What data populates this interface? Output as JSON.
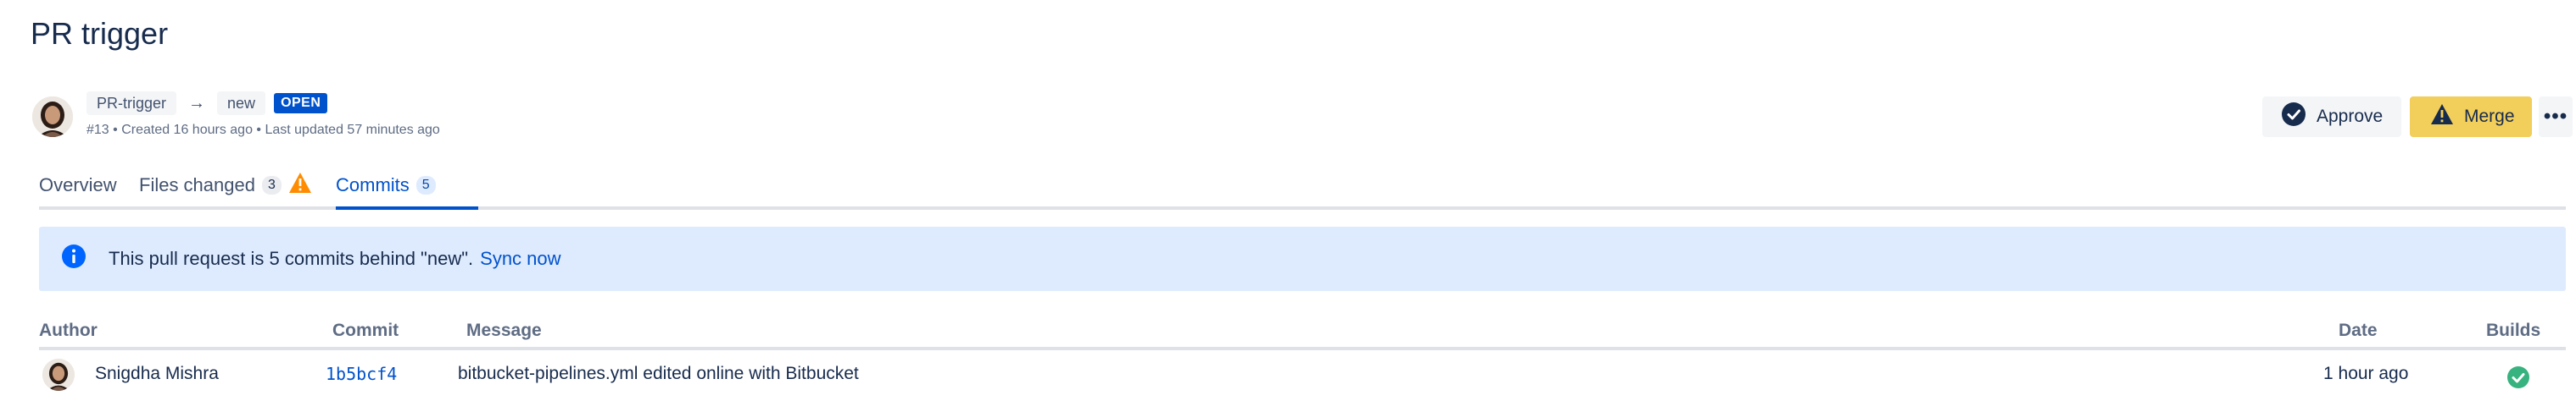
{
  "page": {
    "title": "PR trigger"
  },
  "pr": {
    "source_branch": "PR-trigger",
    "target_branch": "new",
    "status": "OPEN",
    "meta": "#13 • Created 16 hours ago • Last updated 57 minutes ago"
  },
  "actions": {
    "approve_label": "Approve",
    "merge_label": "Merge",
    "more_label": "•••"
  },
  "tabs": [
    {
      "label": "Overview",
      "count": ""
    },
    {
      "label": "Files changed",
      "count": "3"
    },
    {
      "label": "Commits",
      "count": "5"
    }
  ],
  "banner": {
    "text": "This pull request is 5 commits behind \"new\".",
    "link": "Sync now"
  },
  "table": {
    "columns": {
      "author": "Author",
      "commit": "Commit",
      "message": "Message",
      "date": "Date",
      "builds": "Builds"
    },
    "rows": [
      {
        "author": "Snigdha Mishra",
        "commit": "1b5bcf4",
        "message": "bitbucket-pipelines.yml edited online with Bitbucket",
        "date": "1 hour ago",
        "build_status": "success"
      }
    ]
  },
  "icons": {
    "approve": "check-circle-icon",
    "merge": "warning-icon",
    "files_warning": "warning-icon",
    "info": "info-icon",
    "build": "check-circle-icon",
    "branch_arrow": "arrow-right-icon"
  },
  "colors": {
    "primary": "#0052CC",
    "merge_button": "#F2CE5A",
    "banner_bg": "#DEEBFF",
    "warning": "#FF8B00",
    "success": "#36B37E",
    "text": "#172B4D"
  }
}
